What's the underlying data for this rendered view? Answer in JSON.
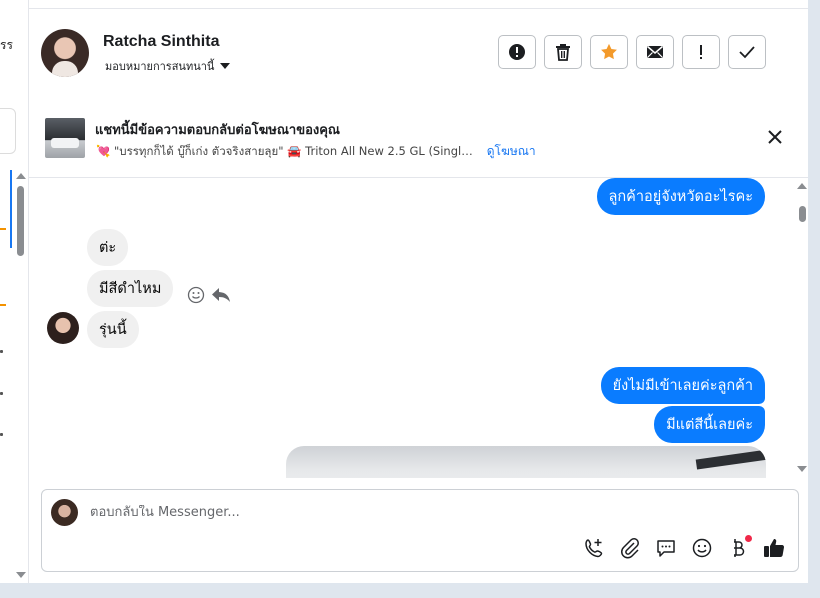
{
  "left_pane": {
    "fragment": "รร"
  },
  "header": {
    "contact_name": "Ratcha Sinthita",
    "assign_label": "มอบหมายการสนทนานี้",
    "actions": [
      {
        "icon": "exclamation-circle-icon",
        "name": "mark-spam-button"
      },
      {
        "icon": "trash-icon",
        "name": "delete-button"
      },
      {
        "icon": "star-icon",
        "name": "star-button"
      },
      {
        "icon": "envelope-icon",
        "name": "mark-unread-button"
      },
      {
        "icon": "exclamation-icon",
        "name": "follow-up-button"
      },
      {
        "icon": "check-icon",
        "name": "mark-done-button"
      }
    ]
  },
  "ad_banner": {
    "title": "แชทนี้มีข้อความตอบกลับต่อโฆษณาของคุณ",
    "subtitle": "💘 \"บรรทุกก็ได้ บู๊ก็เก่ง ตัวจริงสายลุย\" 🚘 Triton All New 2.5 GL (Singl…",
    "link_label": "ดูโฆษณา"
  },
  "messages": [
    {
      "direction": "out",
      "text": "ลูกค้าอยู่จังหวัดอะไรคะ"
    },
    {
      "direction": "in",
      "text": "ต่ะ"
    },
    {
      "direction": "in",
      "text": "มีสีดำไหม"
    },
    {
      "direction": "in",
      "text": "รุ่นนี้"
    },
    {
      "direction": "out",
      "text": "ยังไม่มีเข้าเลยค่ะลูกค้า"
    },
    {
      "direction": "out",
      "text": "มีแต่สีนี้เลยค่ะ"
    }
  ],
  "composer": {
    "placeholder": "ตอบกลับใน Messenger...",
    "tools": [
      "phone-plus-icon",
      "paperclip-icon",
      "chat-bubble-icon",
      "smiley-icon",
      "baht-icon",
      "thumbs-up-icon"
    ]
  },
  "colors": {
    "accent": "#0a7cff",
    "star": "#f39a2b",
    "thumb": "#1c1e21"
  }
}
